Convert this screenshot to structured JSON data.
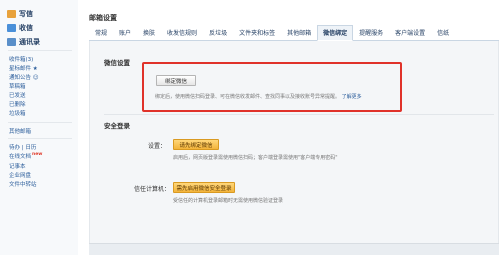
{
  "sidebar": {
    "write": "写信",
    "inbox": "收信",
    "contacts": "通讯录",
    "folders": [
      {
        "label": "收件箱(3)"
      },
      {
        "label": "星标邮件 ★"
      },
      {
        "label": "通知公告 ☺"
      },
      {
        "label": "草稿箱"
      },
      {
        "label": "已发送"
      },
      {
        "label": "已删除"
      },
      {
        "label": "垃圾箱"
      }
    ],
    "other_mail": "其他邮箱",
    "tools": [
      {
        "label": "待办 | 日历"
      },
      {
        "label": "在线文档",
        "badge": "new"
      },
      {
        "label": "记事本"
      },
      {
        "label": "企业网盘"
      },
      {
        "label": "文件中转站"
      }
    ]
  },
  "main": {
    "title": "邮箱设置",
    "tabs": [
      {
        "label": "常规"
      },
      {
        "label": "账户"
      },
      {
        "label": "换肤"
      },
      {
        "label": "收发信规则"
      },
      {
        "label": "反垃圾"
      },
      {
        "label": "文件夹和标签"
      },
      {
        "label": "其他邮箱"
      },
      {
        "label": "微信绑定"
      },
      {
        "label": "提醒服务"
      },
      {
        "label": "客户端设置"
      },
      {
        "label": "信纸"
      }
    ],
    "active_tab": "微信绑定",
    "wechat": {
      "section_title": "微信设置",
      "bind_button": "绑定微信",
      "description": "绑定后，使用微信扫码登录、可在微信收发邮件、查找同事以及接收账号异常提醒。",
      "learn_more": "了解更多"
    },
    "security": {
      "section_title": "安全登录",
      "settings_label": "设置：",
      "settings_button": "请先绑定微信",
      "settings_desc": "启用后，网页版登录需使用微信扫码；客户端登录需使用\"客户端专用密码\"",
      "trusted_label": "信任计算机：",
      "trusted_button": "需先启用微信安全登录",
      "trusted_desc": "受信任的计算机登录邮箱时无需使用微信验证登录"
    }
  },
  "colors": {
    "highlight_box": "#e0322a",
    "link": "#2b5d9b",
    "orange_button": "#f3b43b"
  }
}
